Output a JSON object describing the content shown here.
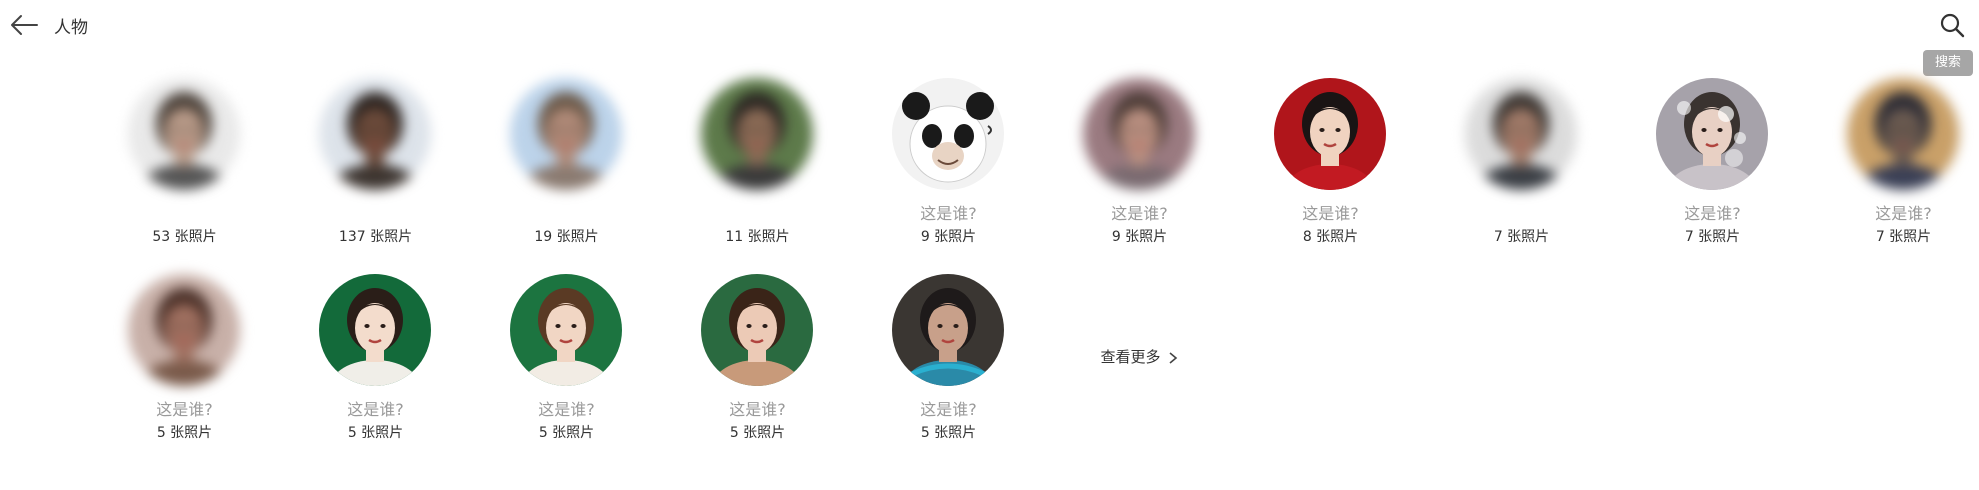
{
  "header": {
    "title": "人物",
    "back_icon": "arrow-left-icon",
    "search_icon": "search-icon",
    "search_tooltip": "搜索"
  },
  "people": [
    {
      "name_hint": "",
      "count": "53 张照片",
      "blurred": true,
      "skin": "#b89a88",
      "hair": "#4a4038",
      "bg": "#e9e9e9",
      "shirt": "#555"
    },
    {
      "name_hint": "",
      "count": "137 张照片",
      "blurred": true,
      "skin": "#6b4a3a",
      "hair": "#2c2420",
      "bg": "#dde3ea",
      "shirt": "#3d3530"
    },
    {
      "name_hint": "",
      "count": "19 张照片",
      "blurred": true,
      "skin": "#b08a78",
      "hair": "#6a5848",
      "bg": "#bcd3ea",
      "shirt": "#8a7a70"
    },
    {
      "name_hint": "",
      "count": "11 张照片",
      "blurred": true,
      "skin": "#8a6a55",
      "hair": "#2a2622",
      "bg": "#5d7a4a",
      "shirt": "#3a3a3a"
    },
    {
      "name_hint": "这是谁?",
      "count": "9 张照片",
      "blurred": false,
      "style": "panda",
      "bg": "#f2f2f2"
    },
    {
      "name_hint": "这是谁?",
      "count": "9 张照片",
      "blurred": true,
      "skin": "#b98f80",
      "hair": "#4a3a35",
      "bg": "#9a7a80",
      "shirt": "#7a6a70"
    },
    {
      "name_hint": "这是谁?",
      "count": "8 张照片",
      "blurred": false,
      "style": "woman",
      "skin": "#f0d3c0",
      "hair": "#1a1414",
      "bg": "#b0151b",
      "shirt": "#c21a22"
    },
    {
      "name_hint": "",
      "count": "7 张照片",
      "blurred": true,
      "skin": "#a07a68",
      "hair": "#3a3430",
      "bg": "#dcdcdc",
      "shirt": "#3a3e44"
    },
    {
      "name_hint": "这是谁?",
      "count": "7 张照片",
      "blurred": false,
      "style": "bokeh",
      "skin": "#e8d0c4",
      "hair": "#3a3330",
      "bg": "#a6a2aa",
      "shirt": "#c8c2c8"
    },
    {
      "name_hint": "这是谁?",
      "count": "7 张照片",
      "blurred": true,
      "skin": "#6a5a50",
      "hair": "#2a2a34",
      "bg": "#c9a068",
      "shirt": "#3a3f55"
    },
    {
      "name_hint": "这是谁?",
      "count": "5 张照片",
      "blurred": true,
      "skin": "#a07060",
      "hair": "#4a3028",
      "bg": "#c8b0a8",
      "shirt": "#7a5a4a"
    },
    {
      "name_hint": "这是谁?",
      "count": "5 张照片",
      "blurred": false,
      "style": "woman",
      "skin": "#f3dccc",
      "hair": "#2a1e18",
      "bg": "#136a3a",
      "shirt": "#f0eee8"
    },
    {
      "name_hint": "这是谁?",
      "count": "5 张照片",
      "blurred": false,
      "style": "woman",
      "skin": "#f1d6c4",
      "hair": "#5a3a24",
      "bg": "#1c7440",
      "shirt": "#f2ece4"
    },
    {
      "name_hint": "这是谁?",
      "count": "5 张照片",
      "blurred": false,
      "style": "woman",
      "skin": "#eccab6",
      "hair": "#3a2418",
      "bg": "#2a6a40",
      "shirt": "#c89a7a"
    },
    {
      "name_hint": "这是谁?",
      "count": "5 张照片",
      "blurred": false,
      "style": "warrior",
      "skin": "#c8a08a",
      "hair": "#1e1a1a",
      "bg": "#3a3632",
      "shirt": "#2a8aa8"
    }
  ],
  "see_more": {
    "label": "查看更多",
    "icon": "chevron-right-icon"
  }
}
